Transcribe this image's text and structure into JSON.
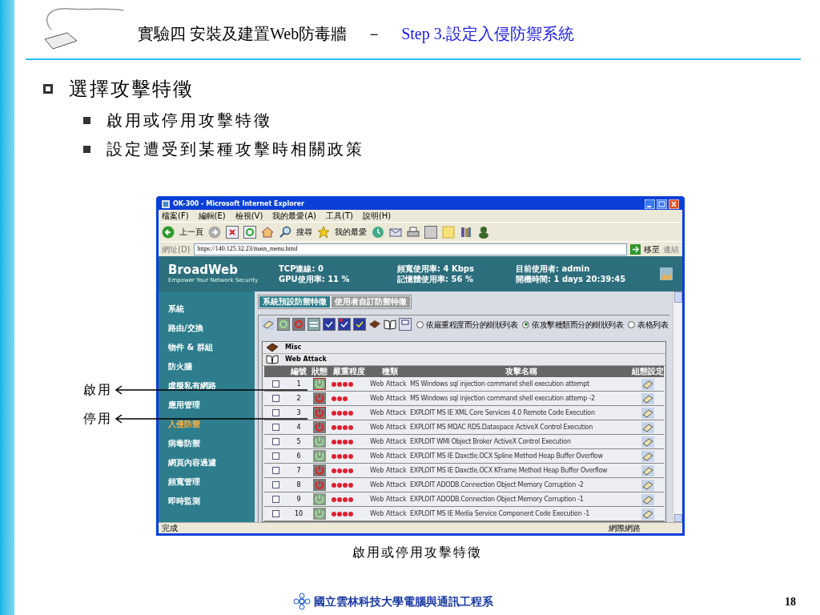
{
  "slide": {
    "header": {
      "title": "實驗四 安裝及建置Web防毒牆",
      "separator": "－",
      "step": "Step 3.設定入侵防禦系統"
    },
    "bullets": [
      {
        "text": "選擇攻擊特徵",
        "children": [
          {
            "text": "啟用或停用攻擊特徵"
          },
          {
            "text": "設定遭受到某種攻擊時相關政策"
          }
        ]
      }
    ],
    "callouts": [
      {
        "label": "啟用"
      },
      {
        "label": "停用"
      }
    ],
    "caption": "啟用或停用攻擊特徵",
    "footer": {
      "school": "國立雲林科技大學電腦與通訊工程系",
      "page": "18"
    }
  },
  "browser": {
    "title": "OK-300 - Microsoft Internet Explorer",
    "menu": [
      "檔案(F)",
      "編輯(E)",
      "檢視(V)",
      "我的最愛(A)",
      "工具(T)",
      "說明(H)"
    ],
    "toolbar": {
      "back": "上一頁",
      "search": "搜尋",
      "favorites": "我的最愛"
    },
    "address": {
      "label": "網址(D)",
      "url": "https://140.125.32.23/main_menu.html",
      "go": "移至",
      "links": "連結"
    },
    "banner": {
      "logo": "BroadWeb",
      "tagline": "Empower Your Network Security",
      "stats": [
        [
          "TCP連線: 0",
          "GPU使用率: 11 %"
        ],
        [
          "頻寬使用率: 4  Kbps",
          "記憶體使用率: 56 %"
        ],
        [
          "目前使用者: admin",
          "開機時間: 1 days 20:39:45"
        ]
      ]
    },
    "sidebar": [
      {
        "label": "系統",
        "selected": false
      },
      {
        "label": "路由/交換",
        "selected": false
      },
      {
        "label": "物件 & 群組",
        "selected": false
      },
      {
        "label": "防火牆",
        "selected": false
      },
      {
        "label": "虛擬私有網路",
        "selected": false
      },
      {
        "label": "應用管理",
        "selected": false
      },
      {
        "label": "入侵防禦",
        "selected": true
      },
      {
        "label": "病毒防禦",
        "selected": false
      },
      {
        "label": "網頁內容過濾",
        "selected": false
      },
      {
        "label": "頻寬管理",
        "selected": false
      },
      {
        "label": "即時監測",
        "selected": false
      }
    ],
    "tabs": [
      {
        "label": "系統預設防禦特徵",
        "selected": true
      },
      {
        "label": "使用者自訂防禦特徵",
        "selected": false
      }
    ],
    "views": [
      {
        "label": "依嚴重程度而分的樹狀列表",
        "selected": false
      },
      {
        "label": "依攻擊種類而分的樹狀列表",
        "selected": true
      },
      {
        "label": "表格列表",
        "selected": false
      }
    ],
    "groups": [
      {
        "kind": "closed",
        "label": "Misc"
      },
      {
        "kind": "open",
        "label": "Web Attack"
      }
    ],
    "table": {
      "columns": [
        "編號",
        "狀態",
        "嚴重程度",
        "種類",
        "攻擊名稱",
        "組態設定"
      ],
      "rows": [
        {
          "checked": false,
          "number": "1",
          "enabled": true,
          "highlighted": true,
          "stars": 4,
          "type": "Web Attack",
          "name": "MS Windows sql injection command shell execution attempt"
        },
        {
          "checked": false,
          "number": "2",
          "enabled": false,
          "highlighted": false,
          "stars": 3,
          "type": "Web Attack",
          "name": "MS Windows sql injection command shell execution attemp -2"
        },
        {
          "checked": false,
          "number": "3",
          "enabled": false,
          "highlighted": true,
          "stars": 4,
          "type": "Web Attack",
          "name": "EXPLOIT MS IE XML Core Services 4.0 Remote Code Execution"
        },
        {
          "checked": false,
          "number": "4",
          "enabled": false,
          "highlighted": false,
          "stars": 4,
          "type": "Web Attack",
          "name": "EXPLOIT MS MDAC RDS.Dataspace ActiveX Control Execution"
        },
        {
          "checked": false,
          "number": "5",
          "enabled": true,
          "highlighted": false,
          "stars": 4,
          "type": "Web Attack",
          "name": "EXPLOIT WMI Object Broker ActiveX Control Execution"
        },
        {
          "checked": false,
          "number": "6",
          "enabled": true,
          "highlighted": false,
          "stars": 4,
          "type": "Web Attack",
          "name": "EXPLOIT MS IE Daxctle.OCX Spline Method Heap Buffer Overflow"
        },
        {
          "checked": false,
          "number": "7",
          "enabled": false,
          "highlighted": false,
          "stars": 4,
          "type": "Web Attack",
          "name": "EXPLOIT MS IE Daxctle.OCX KFrame Method Heap Buffer Overflow"
        },
        {
          "checked": false,
          "number": "8",
          "enabled": false,
          "highlighted": false,
          "stars": 4,
          "type": "Web Attack",
          "name": "EXPLOIT ADODB.Connection Object Memory Corruption -2"
        },
        {
          "checked": false,
          "number": "9",
          "enabled": true,
          "highlighted": false,
          "stars": 4,
          "type": "Web Attack",
          "name": "EXPLOIT ADODB.Connection Object Memory Corruption -1"
        },
        {
          "checked": false,
          "number": "10",
          "enabled": true,
          "highlighted": false,
          "stars": 4,
          "type": "Web Attack",
          "name": "EXPLOIT MS IE Media Service Component Code Execution -1"
        }
      ]
    },
    "status": {
      "text": "完成",
      "zone": "網際網路"
    }
  }
}
